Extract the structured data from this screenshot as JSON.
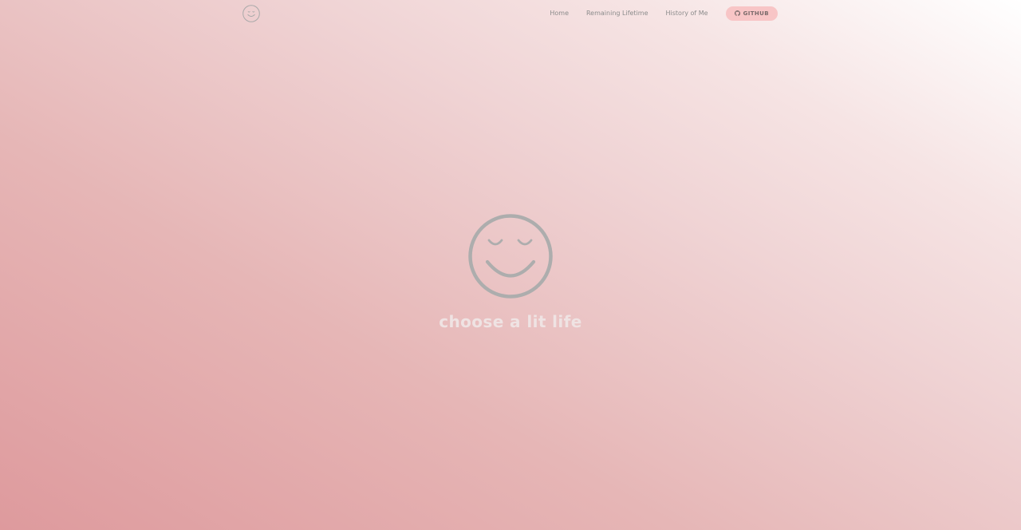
{
  "navbar": {
    "logo_icon": "smiley-face-icon",
    "links": [
      {
        "label": "Home"
      },
      {
        "label": "Remaining Lifetime"
      },
      {
        "label": "History of Me"
      }
    ],
    "github": {
      "icon": "github-icon",
      "label": "GITHUB"
    }
  },
  "hero": {
    "icon": "smiley-face-icon",
    "tagline": "choose a lit life"
  },
  "colors": {
    "gradient_dark": "#de9a9d",
    "gradient_light": "#ffffff",
    "github_button_bg": "#f8c5c6",
    "icon_gray": "#adadad",
    "nav_text": "#8c8c8c",
    "tagline_text": "#efe3e3"
  }
}
